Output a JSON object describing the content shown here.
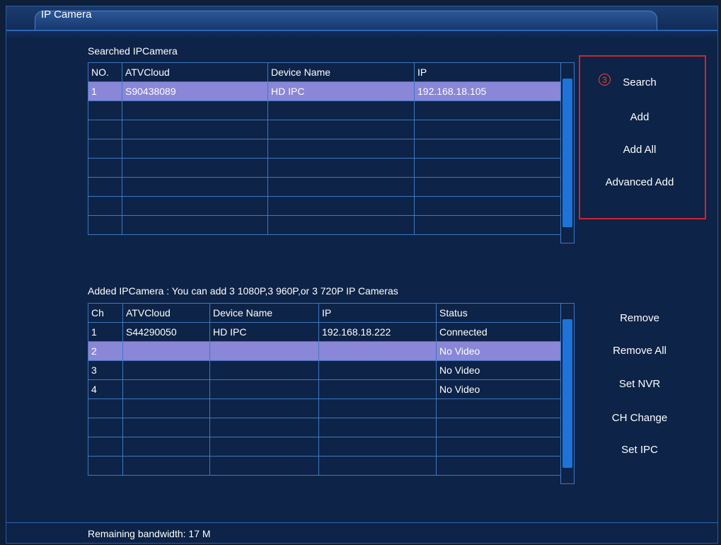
{
  "window": {
    "title": "IP Camera"
  },
  "searched": {
    "title": "Searched IPCamera",
    "headers": [
      "NO.",
      "ATVCloud",
      "Device Name",
      "IP"
    ],
    "rows": [
      [
        "1",
        "S90438089",
        "HD IPC",
        "192.168.18.105"
      ],
      [
        "",
        "",
        "",
        ""
      ],
      [
        "",
        "",
        "",
        ""
      ],
      [
        "",
        "",
        "",
        ""
      ],
      [
        "",
        "",
        "",
        ""
      ],
      [
        "",
        "",
        "",
        ""
      ],
      [
        "",
        "",
        "",
        ""
      ],
      [
        "",
        "",
        "",
        ""
      ]
    ],
    "selected_row": 0
  },
  "search_buttons": {
    "step": "3",
    "search": "Search",
    "add": "Add",
    "add_all": "Add All",
    "advanced_add": "Advanced Add"
  },
  "added": {
    "title": "Added IPCamera : You can add 3 1080P,3 960P,or 3 720P IP Cameras",
    "headers": [
      "Ch",
      "ATVCloud",
      "Device Name",
      "IP",
      "Status"
    ],
    "rows": [
      [
        "1",
        "S44290050",
        "HD IPC",
        "192.168.18.222",
        "Connected"
      ],
      [
        "2",
        "",
        "",
        "",
        "No Video"
      ],
      [
        "3",
        "",
        "",
        "",
        "No Video"
      ],
      [
        "4",
        "",
        "",
        "",
        "No Video"
      ],
      [
        "",
        "",
        "",
        "",
        ""
      ],
      [
        "",
        "",
        "",
        "",
        ""
      ],
      [
        "",
        "",
        "",
        "",
        ""
      ],
      [
        "",
        "",
        "",
        "",
        ""
      ]
    ],
    "selected_row": 1
  },
  "added_buttons": {
    "remove": "Remove",
    "remove_all": "Remove All",
    "set_nvr": "Set NVR",
    "ch_change": "CH Change",
    "set_ipc": "Set IPC"
  },
  "footer": {
    "bandwidth": "Remaining bandwidth: 17 M"
  },
  "colors": {
    "background": "#0d2347",
    "grid_line": "#3f78c1",
    "selected_row": "#8a86d8",
    "scroll_thumb": "#1f73d8",
    "highlight": "#d2242b"
  }
}
